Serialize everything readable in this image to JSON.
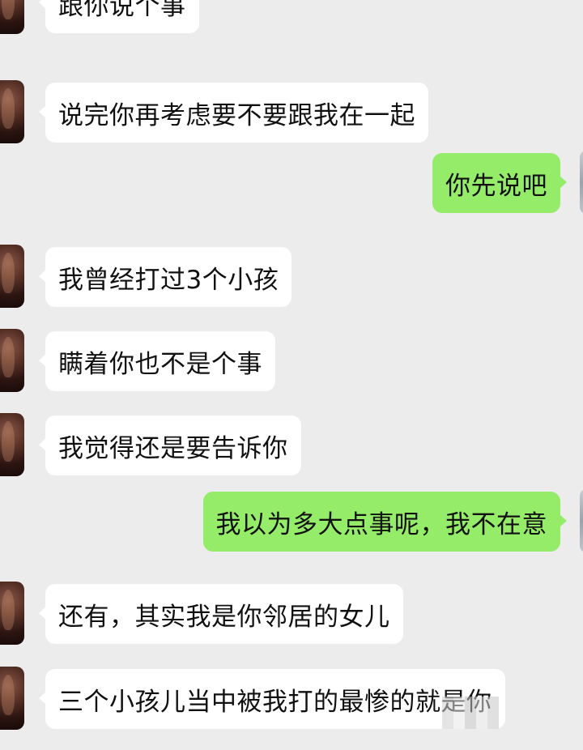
{
  "messages": [
    {
      "side": "in",
      "text": "跟你说个事"
    },
    {
      "side": "in",
      "text": "说完你再考虑要不要跟我在一起"
    },
    {
      "side": "out",
      "text": "你先说吧"
    },
    {
      "side": "in",
      "text": "我曾经打过3个小孩"
    },
    {
      "side": "in",
      "text": "瞒着你也不是个事"
    },
    {
      "side": "in",
      "text": "我觉得还是要告诉你"
    },
    {
      "side": "out",
      "text": "我以为多大点事呢，我不在意"
    },
    {
      "side": "in",
      "text": "还有，其实我是你邻居的女儿"
    },
    {
      "side": "in",
      "text": "三个小孩儿当中被我打的最惨的就是你"
    }
  ],
  "colors": {
    "background": "#ececec",
    "incoming_bubble": "#ffffff",
    "outgoing_bubble": "#95ec69"
  }
}
